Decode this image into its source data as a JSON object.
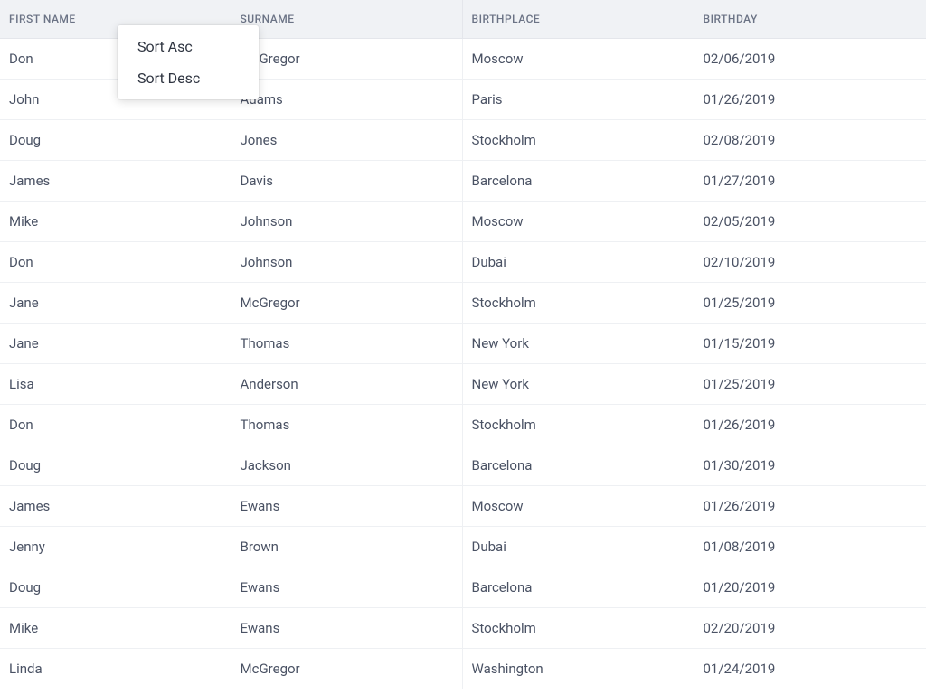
{
  "table": {
    "headers": {
      "firstname": "FIRST NAME",
      "surname": "SURNAME",
      "birthplace": "BIRTHPLACE",
      "birthday": "BIRTHDAY"
    },
    "rows": [
      {
        "firstname": "Don",
        "surname": "McGregor",
        "birthplace": "Moscow",
        "birthday": "02/06/2019"
      },
      {
        "firstname": "John",
        "surname": "Adams",
        "birthplace": "Paris",
        "birthday": "01/26/2019"
      },
      {
        "firstname": "Doug",
        "surname": "Jones",
        "birthplace": "Stockholm",
        "birthday": "02/08/2019"
      },
      {
        "firstname": "James",
        "surname": "Davis",
        "birthplace": "Barcelona",
        "birthday": "01/27/2019"
      },
      {
        "firstname": "Mike",
        "surname": "Johnson",
        "birthplace": "Moscow",
        "birthday": "02/05/2019"
      },
      {
        "firstname": "Don",
        "surname": "Johnson",
        "birthplace": "Dubai",
        "birthday": "02/10/2019"
      },
      {
        "firstname": "Jane",
        "surname": "McGregor",
        "birthplace": "Stockholm",
        "birthday": "01/25/2019"
      },
      {
        "firstname": "Jane",
        "surname": "Thomas",
        "birthplace": "New York",
        "birthday": "01/15/2019"
      },
      {
        "firstname": "Lisa",
        "surname": "Anderson",
        "birthplace": "New York",
        "birthday": "01/25/2019"
      },
      {
        "firstname": "Don",
        "surname": "Thomas",
        "birthplace": "Stockholm",
        "birthday": "01/26/2019"
      },
      {
        "firstname": "Doug",
        "surname": "Jackson",
        "birthplace": "Barcelona",
        "birthday": "01/30/2019"
      },
      {
        "firstname": "James",
        "surname": "Ewans",
        "birthplace": "Moscow",
        "birthday": "01/26/2019"
      },
      {
        "firstname": "Jenny",
        "surname": "Brown",
        "birthplace": "Dubai",
        "birthday": "01/08/2019"
      },
      {
        "firstname": "Doug",
        "surname": "Ewans",
        "birthplace": "Barcelona",
        "birthday": "01/20/2019"
      },
      {
        "firstname": "Mike",
        "surname": "Ewans",
        "birthplace": "Stockholm",
        "birthday": "02/20/2019"
      },
      {
        "firstname": "Linda",
        "surname": "McGregor",
        "birthplace": "Washington",
        "birthday": "01/24/2019"
      }
    ]
  },
  "contextMenu": {
    "sortAsc": "Sort Asc",
    "sortDesc": "Sort Desc"
  }
}
